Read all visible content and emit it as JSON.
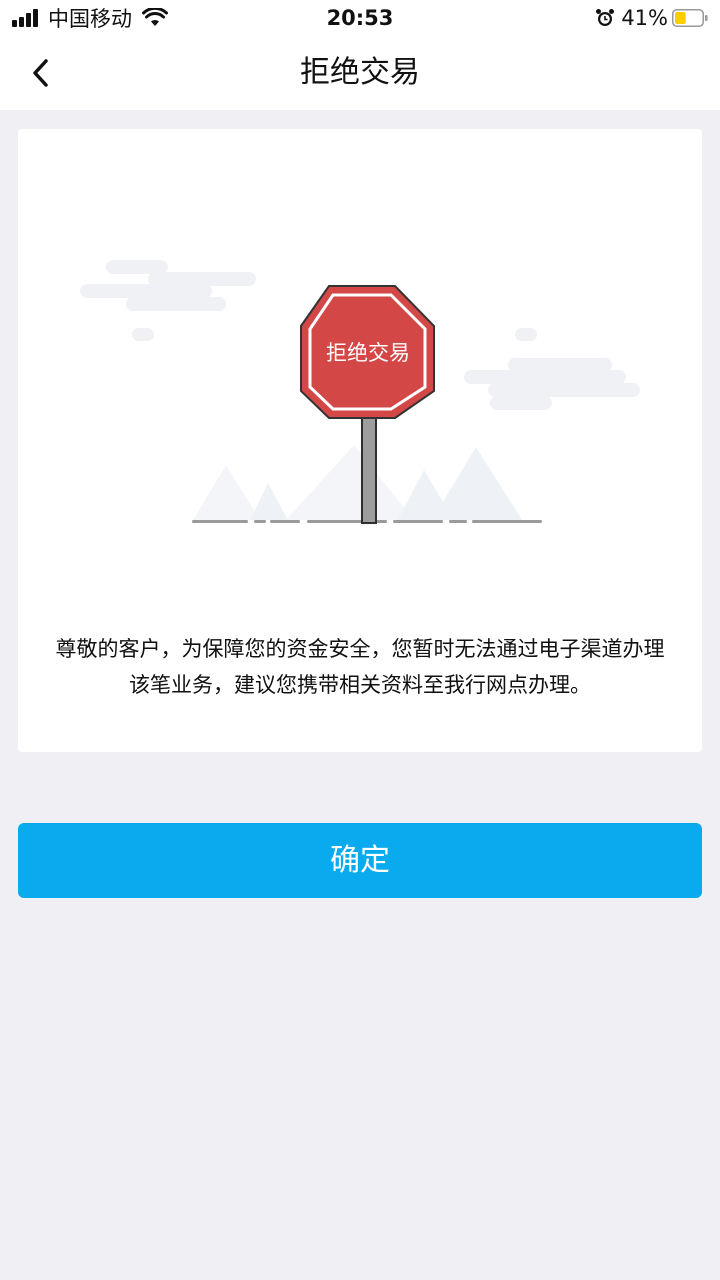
{
  "status_bar": {
    "carrier": "中国移动",
    "time": "20:53",
    "battery_percent": "41%",
    "battery_level": 0.41
  },
  "nav": {
    "title": "拒绝交易",
    "back_icon": "chevron-left-icon"
  },
  "card": {
    "sign_text": "拒绝交易",
    "message_line1": "尊敬的客户，为保障您的资金安全，您暂时无法通过电子渠道办理",
    "message_line2": "该笔业务，建议您携带相关资料至我行网点办理。"
  },
  "confirm_button": {
    "label": "确定"
  },
  "colors": {
    "background": "#efeff4",
    "accent": "#09aaee",
    "sign_red": "#d34747",
    "battery_yellow": "#ffcc00"
  }
}
